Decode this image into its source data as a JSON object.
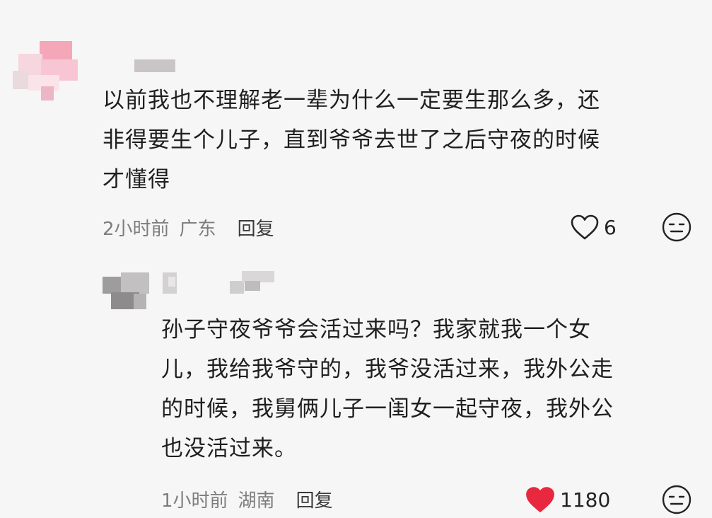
{
  "comments": [
    {
      "text_lines": [
        "以前我也不理解老一辈为什么一定要生那么多，还",
        "非得要生个儿子，直到爷爷去世了之后守夜的时候",
        "才懂得"
      ],
      "time": "2小时前",
      "location": "广东",
      "reply_label": "回复",
      "likes": "6",
      "liked": false,
      "heart_icon": "heart-outline-icon",
      "emoji_icon": "expressionless-face-icon"
    },
    {
      "text_lines": [
        "孙子守夜爷爷会活过来吗？我家就我一个女",
        "儿，我给我爷守的，我爷没活过来，我外公走",
        "的时候，我舅俩儿子一闺女一起守夜，我外公",
        "也没活过来。"
      ],
      "time": "1小时前",
      "location": "湖南",
      "reply_label": "回复",
      "likes": "1180",
      "liked": true,
      "heart_icon": "heart-filled-icon",
      "emoji_icon": "expressionless-face-icon"
    }
  ],
  "colors": {
    "background": "#f7f6f6",
    "text": "#1f1f1f",
    "meta": "#7d7d7d",
    "liked_heart": "#e8283f"
  }
}
